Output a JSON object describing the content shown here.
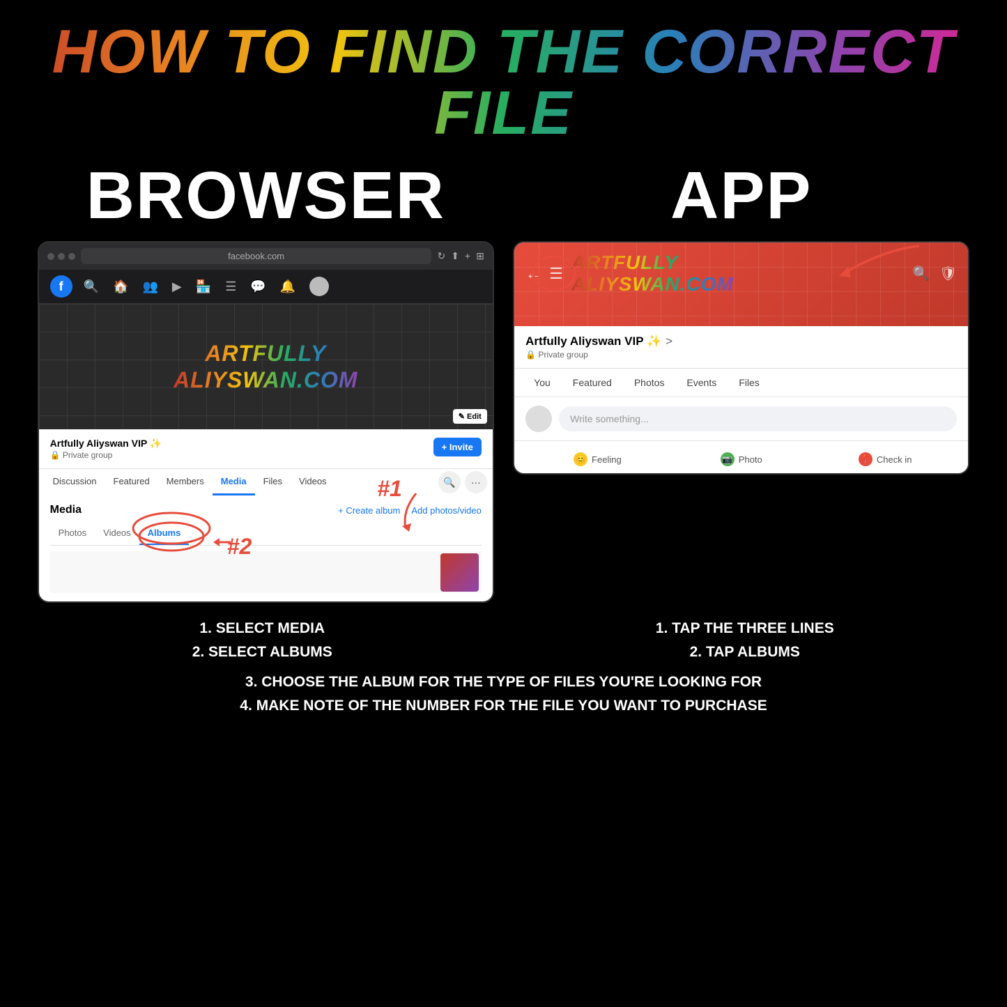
{
  "title": "HOW TO FIND THE CORRECT FILE",
  "col_browser": "BROWSER",
  "col_app": "APP",
  "browser": {
    "url": "facebook.com",
    "fb_group_name": "Artfully Aliyswan VIP ✨",
    "fb_private": "🔒 Private group",
    "tabs": [
      "Discussion",
      "Featured",
      "Members",
      "Media",
      "Files",
      "Videos"
    ],
    "active_tab": "Media",
    "media_title": "Media",
    "media_sub_tabs": [
      "Photos",
      "Videos",
      "Albums"
    ],
    "active_media_tab": "Albums",
    "annotation1": "#1",
    "annotation2": "#2",
    "hero_text_line1": "ARTFULLY",
    "hero_text_line2": "ALIYSWAN.COM",
    "edit_btn": "✎ Edit",
    "invite_btn": "+ Invite",
    "create_album": "+ Create album",
    "add_photos": "Add photos/video"
  },
  "app": {
    "group_name": "Artfully Aliyswan VIP ✨",
    "chevron": ">",
    "private": "🔒 Private group",
    "tabs": [
      "You",
      "Featured",
      "Photos",
      "Events",
      "Files"
    ],
    "header_text_line1": "ARTFULLY",
    "header_text_line2": "ALIYSWAN.COM",
    "write_placeholder": "Write something...",
    "feeling_label": "Feeling",
    "photo_label": "Photo",
    "checkin_label": "Check in"
  },
  "instructions": {
    "browser_steps": "1. SELECT MEDIA\n2. SELECT ALBUMS",
    "app_steps": "1. TAP THE THREE LINES\n2. TAP ALBUMS",
    "full_line3": "3. CHOOSE THE ALBUM FOR THE TYPE OF FILES YOU'RE LOOKING FOR",
    "full_line4": "4. MAKE NOTE OF THE NUMBER FOR THE FILE YOU WANT TO PURCHASE"
  }
}
